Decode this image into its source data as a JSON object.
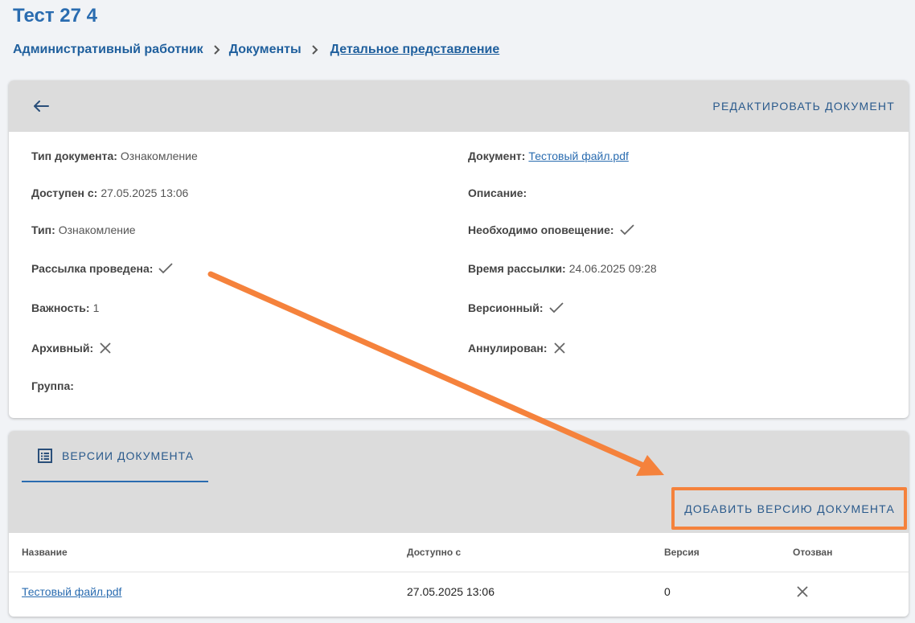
{
  "page": {
    "title": "Тест 27 4"
  },
  "breadcrumb": {
    "items": [
      "Административный работник",
      "Документы"
    ],
    "current": "Детальное представление"
  },
  "document": {
    "edit_label": "РЕДАКТИРОВАТЬ ДОКУМЕНТ",
    "fields": {
      "doc_type_label": "Тип документа:",
      "doc_type_value": "Ознакомление",
      "available_label": "Доступен с:",
      "available_value": "27.05.2025 13:06",
      "type_label": "Тип:",
      "type_value": "Ознакомление",
      "mailing_done_label": "Рассылка проведена:",
      "importance_label": "Важность:",
      "importance_value": "1",
      "archived_label": "Архивный:",
      "group_label": "Группа:",
      "document_label": "Документ:",
      "document_value": "Тестовый файл.pdf",
      "description_label": "Описание:",
      "notify_label": "Необходимо оповещение:",
      "mailing_time_label": "Время рассылки:",
      "mailing_time_value": "24.06.2025 09:28",
      "versioned_label": "Версионный:",
      "cancelled_label": "Аннулирован:"
    },
    "flags": {
      "mailing_done": true,
      "archived": false,
      "notify": true,
      "versioned": true,
      "cancelled": false
    }
  },
  "versions": {
    "tab_label": "ВЕРСИИ ДОКУМЕНТА",
    "add_label": "ДОБАВИТЬ ВЕРСИЮ ДОКУМЕНТА",
    "columns": [
      "Название",
      "Доступно с",
      "Версия",
      "Отозван"
    ],
    "rows": [
      {
        "name": "Тестовый файл.pdf",
        "available": "27.05.2025 13:06",
        "version": "0",
        "revoked": false
      }
    ]
  },
  "annotation": {
    "color": "#f5823c"
  }
}
